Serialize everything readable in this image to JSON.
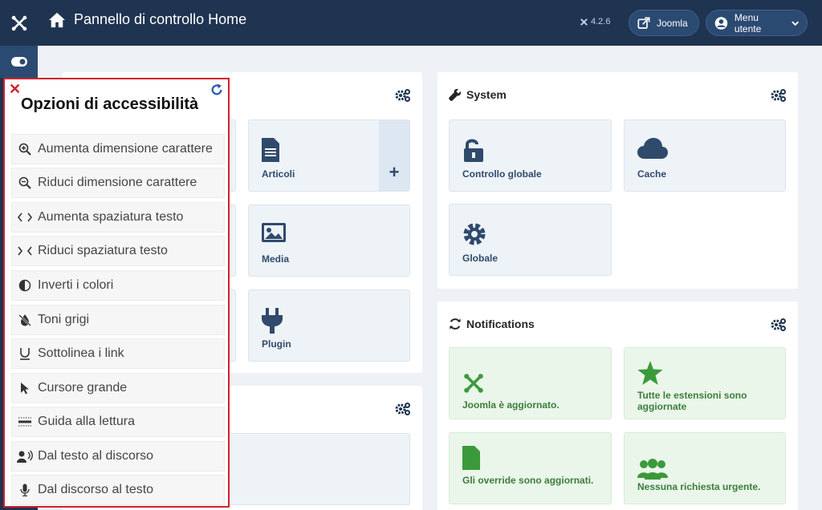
{
  "header": {
    "title": "Pannello di controllo Home",
    "version": "4.2.6",
    "joomla_button": "Joomla",
    "user_menu": "Menu utente"
  },
  "content_card": {
    "tiles": {
      "articles": "Articoli",
      "media": "Media",
      "plugin": "Plugin"
    }
  },
  "system_card": {
    "title": "System",
    "tiles": {
      "global_checkin": "Controllo globale",
      "cache": "Cache",
      "global": "Globale"
    }
  },
  "notifications_card": {
    "title": "Notifications",
    "tiles": {
      "joomla_updated": "Joomla è aggiornato.",
      "extensions_updated": "Tutte le estensioni sono aggiornate",
      "overrides_updated": "Gli override sono aggiornati.",
      "no_privacy_requests": "Nessuna richiesta urgente."
    }
  },
  "accessibility": {
    "title": "Opzioni di accessibilità",
    "items": [
      {
        "label": "Aumenta dimensione carattere",
        "icon": "zoom-in-icon"
      },
      {
        "label": "Riduci dimensione carattere",
        "icon": "zoom-out-icon"
      },
      {
        "label": "Aumenta spaziatura testo",
        "icon": "increase-spacing-icon"
      },
      {
        "label": "Riduci spaziatura testo",
        "icon": "decrease-spacing-icon"
      },
      {
        "label": "Inverti i colori",
        "icon": "contrast-icon"
      },
      {
        "label": "Toni grigi",
        "icon": "grayscale-icon"
      },
      {
        "label": "Sottolinea i link",
        "icon": "underline-icon"
      },
      {
        "label": "Cursore grande",
        "icon": "cursor-icon"
      },
      {
        "label": "Guida alla lettura",
        "icon": "reading-guide-icon"
      },
      {
        "label": "Dal testo al discorso",
        "icon": "text-to-speech-icon"
      },
      {
        "label": "Dal discorso al testo",
        "icon": "microphone-icon"
      }
    ]
  },
  "colors": {
    "header_bg": "#1f3451",
    "tile_bg": "#eef3f8",
    "notification_green": "#3a7e3a",
    "panel_border": "#d0202a"
  }
}
